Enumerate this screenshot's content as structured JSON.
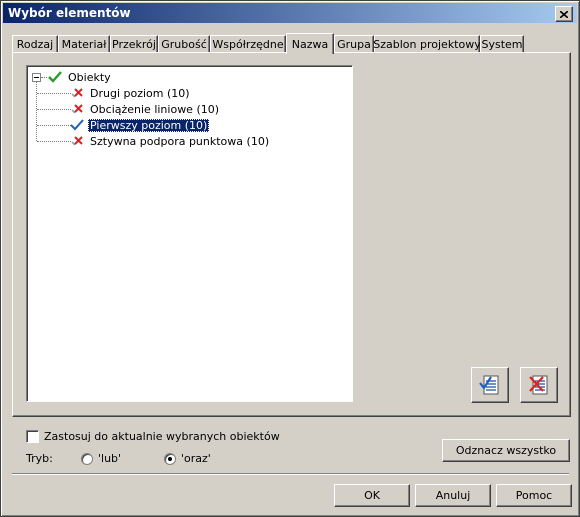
{
  "window": {
    "title": "Wybór elementów"
  },
  "tabs": [
    {
      "label": "Rodzaj"
    },
    {
      "label": "Materiał"
    },
    {
      "label": "Przekrój"
    },
    {
      "label": "Grubość"
    },
    {
      "label": "Współrzędne"
    },
    {
      "label": "Nazwa",
      "active": true
    },
    {
      "label": "Grupa"
    },
    {
      "label": "Szablon projektowy"
    },
    {
      "label": "System"
    }
  ],
  "tree": {
    "root": {
      "label": "Obiekty",
      "expanded": true,
      "icon": "green-check-icon"
    },
    "items": [
      {
        "label": "Drugi poziom (10)",
        "icon": "red-x-icon"
      },
      {
        "label": "Obciążenie liniowe (10)",
        "icon": "red-x-icon"
      },
      {
        "label": "Pierwszy poziom (10)",
        "icon": "blue-check-icon",
        "selected": true
      },
      {
        "label": "Sztywna podpora punktowa (10)",
        "icon": "red-x-icon"
      }
    ]
  },
  "options": {
    "apply_current_label": "Zastosuj do aktualnie wybranych obiektów",
    "apply_current_checked": false,
    "mode_label": "Tryb:",
    "mode_or_label": "'lub'",
    "mode_and_label": "'oraz'",
    "mode_selected": "oraz"
  },
  "buttons": {
    "deselect_all": "Odznacz wszystko",
    "ok": "OK",
    "cancel": "Anuluj",
    "help": "Pomoc"
  },
  "colors": {
    "titlebar_start": "#0a246a",
    "titlebar_end": "#a6caf0",
    "selection": "#0a246a",
    "face": "#d4d0c8"
  }
}
